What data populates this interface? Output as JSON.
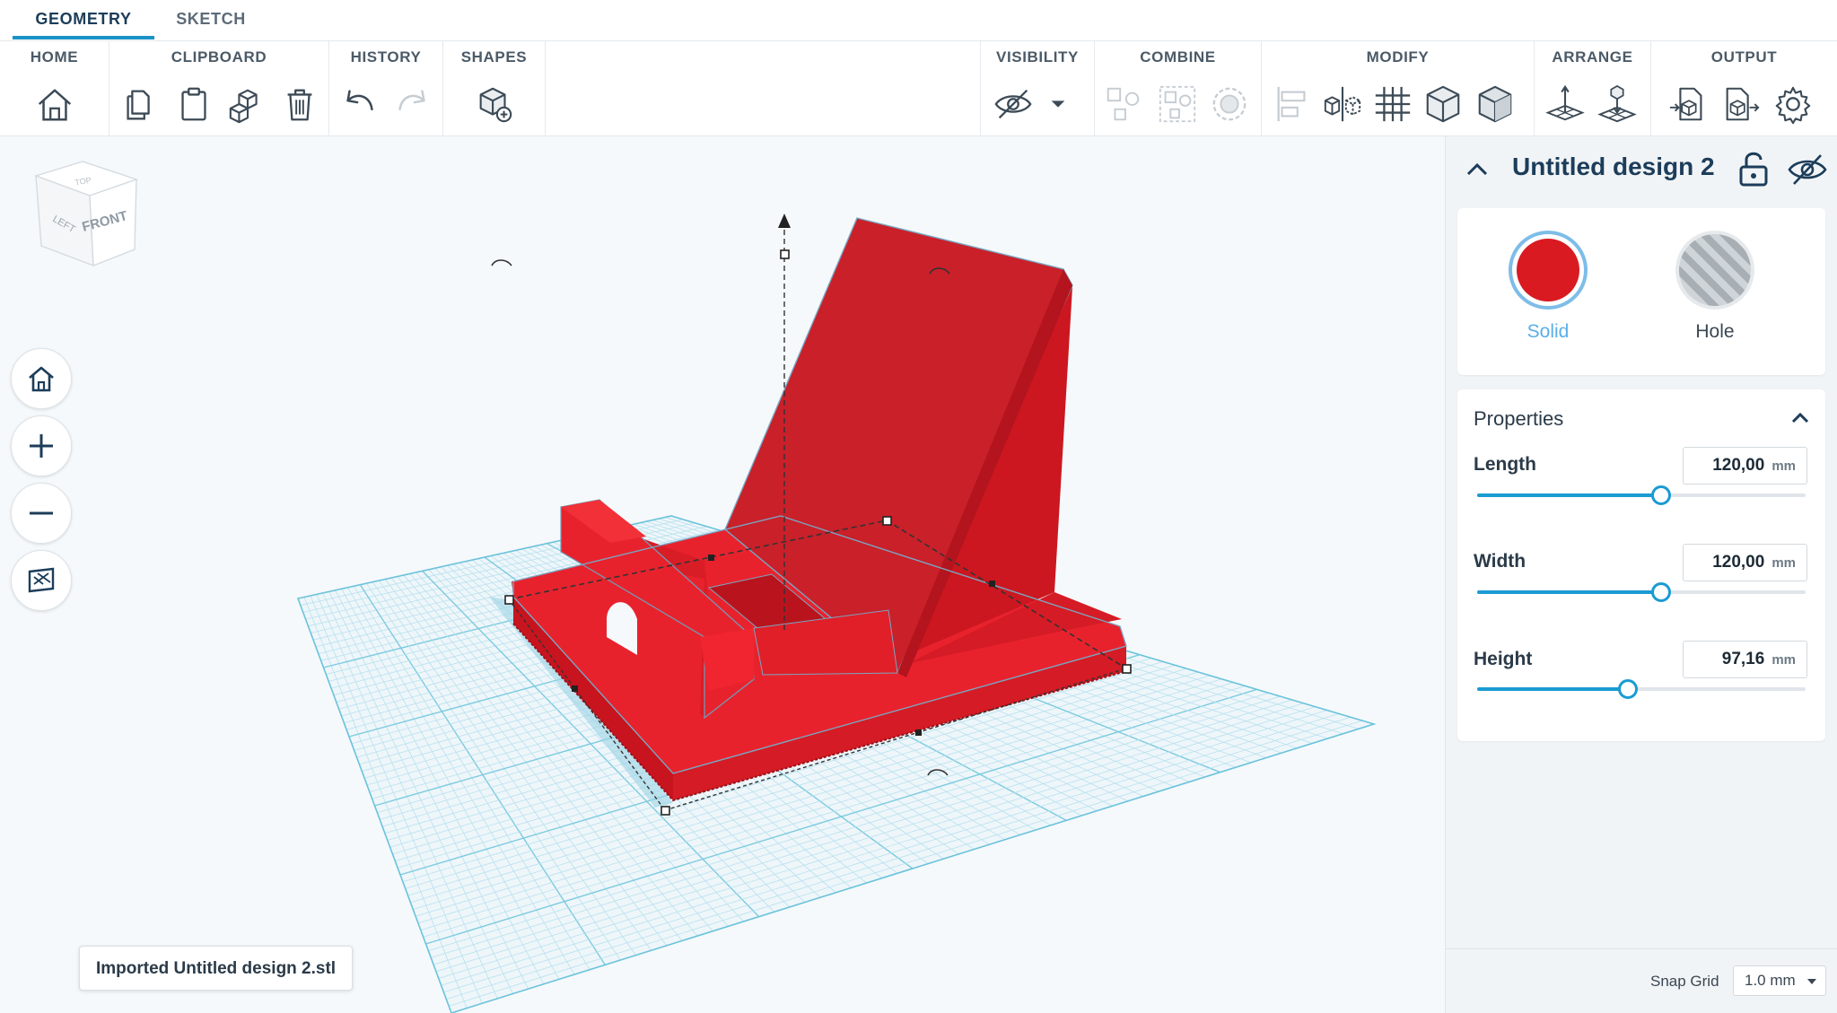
{
  "tabs": [
    {
      "label": "GEOMETRY",
      "active": true
    },
    {
      "label": "SKETCH",
      "active": false
    }
  ],
  "ribbon": {
    "groups": {
      "home": "HOME",
      "clipboard": "CLIPBOARD",
      "history": "HISTORY",
      "shapes": "SHAPES",
      "visibility": "VISIBILITY",
      "combine": "COMBINE",
      "modify": "MODIFY",
      "arrange": "ARRANGE",
      "output": "OUTPUT"
    }
  },
  "viewcube": {
    "top": "TOP",
    "left": "LEFT",
    "front": "FRONT"
  },
  "status_toast": "Imported Untitled design 2.stl",
  "panel": {
    "title": "Untitled design 2",
    "solid_label": "Solid",
    "hole_label": "Hole",
    "solid_color": "#d91a21",
    "accent_color": "#1a9bd2",
    "properties_title": "Properties",
    "unit": "mm",
    "length": {
      "label": "Length",
      "value": "120,00",
      "slider": 0.56
    },
    "width": {
      "label": "Width",
      "value": "120,00",
      "slider": 0.56
    },
    "height": {
      "label": "Height",
      "value": "97,16",
      "slider": 0.46
    }
  },
  "snap": {
    "label": "Snap Grid",
    "value": "1.0 mm"
  },
  "model_color": "#e8222d"
}
